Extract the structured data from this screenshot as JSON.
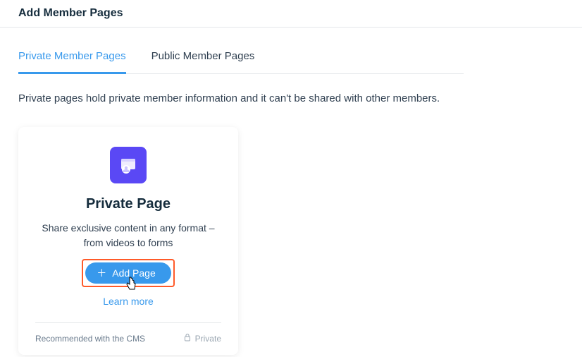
{
  "header": {
    "title": "Add Member Pages"
  },
  "tabs": {
    "items": [
      {
        "label": "Private Member Pages",
        "active": true
      },
      {
        "label": "Public Member Pages",
        "active": false
      }
    ]
  },
  "description": "Private pages hold private member information and it can't be shared with other members.",
  "card": {
    "icon": "private-page-icon",
    "title": "Private Page",
    "subtitle": "Share exclusive content in any format – from videos to forms",
    "add_button": "Add Page",
    "learn_more": "Learn more",
    "footer_left": "Recommended with the CMS",
    "footer_right": "Private"
  }
}
